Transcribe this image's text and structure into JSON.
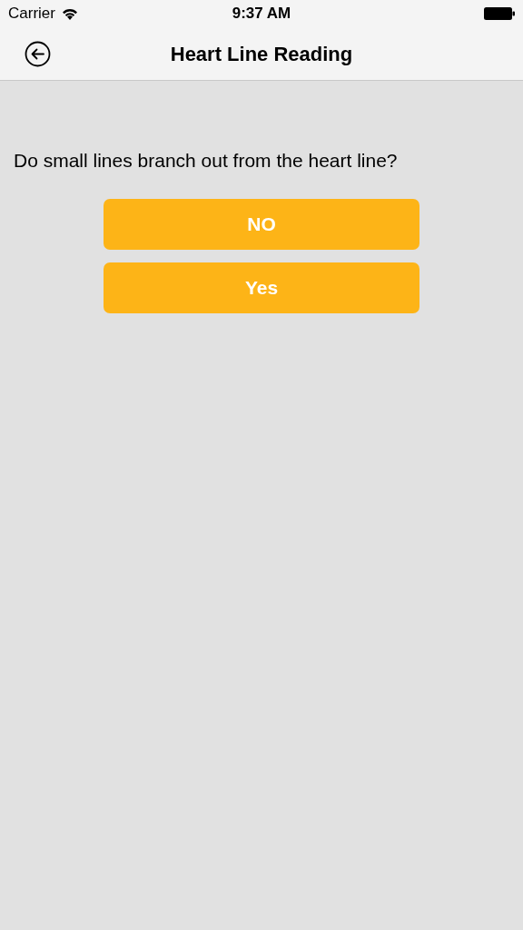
{
  "status_bar": {
    "carrier": "Carrier",
    "time": "9:37 AM"
  },
  "nav_bar": {
    "title": "Heart Line Reading"
  },
  "question": "Do small lines branch out from the heart line?",
  "answers": [
    "NO",
    "Yes"
  ]
}
